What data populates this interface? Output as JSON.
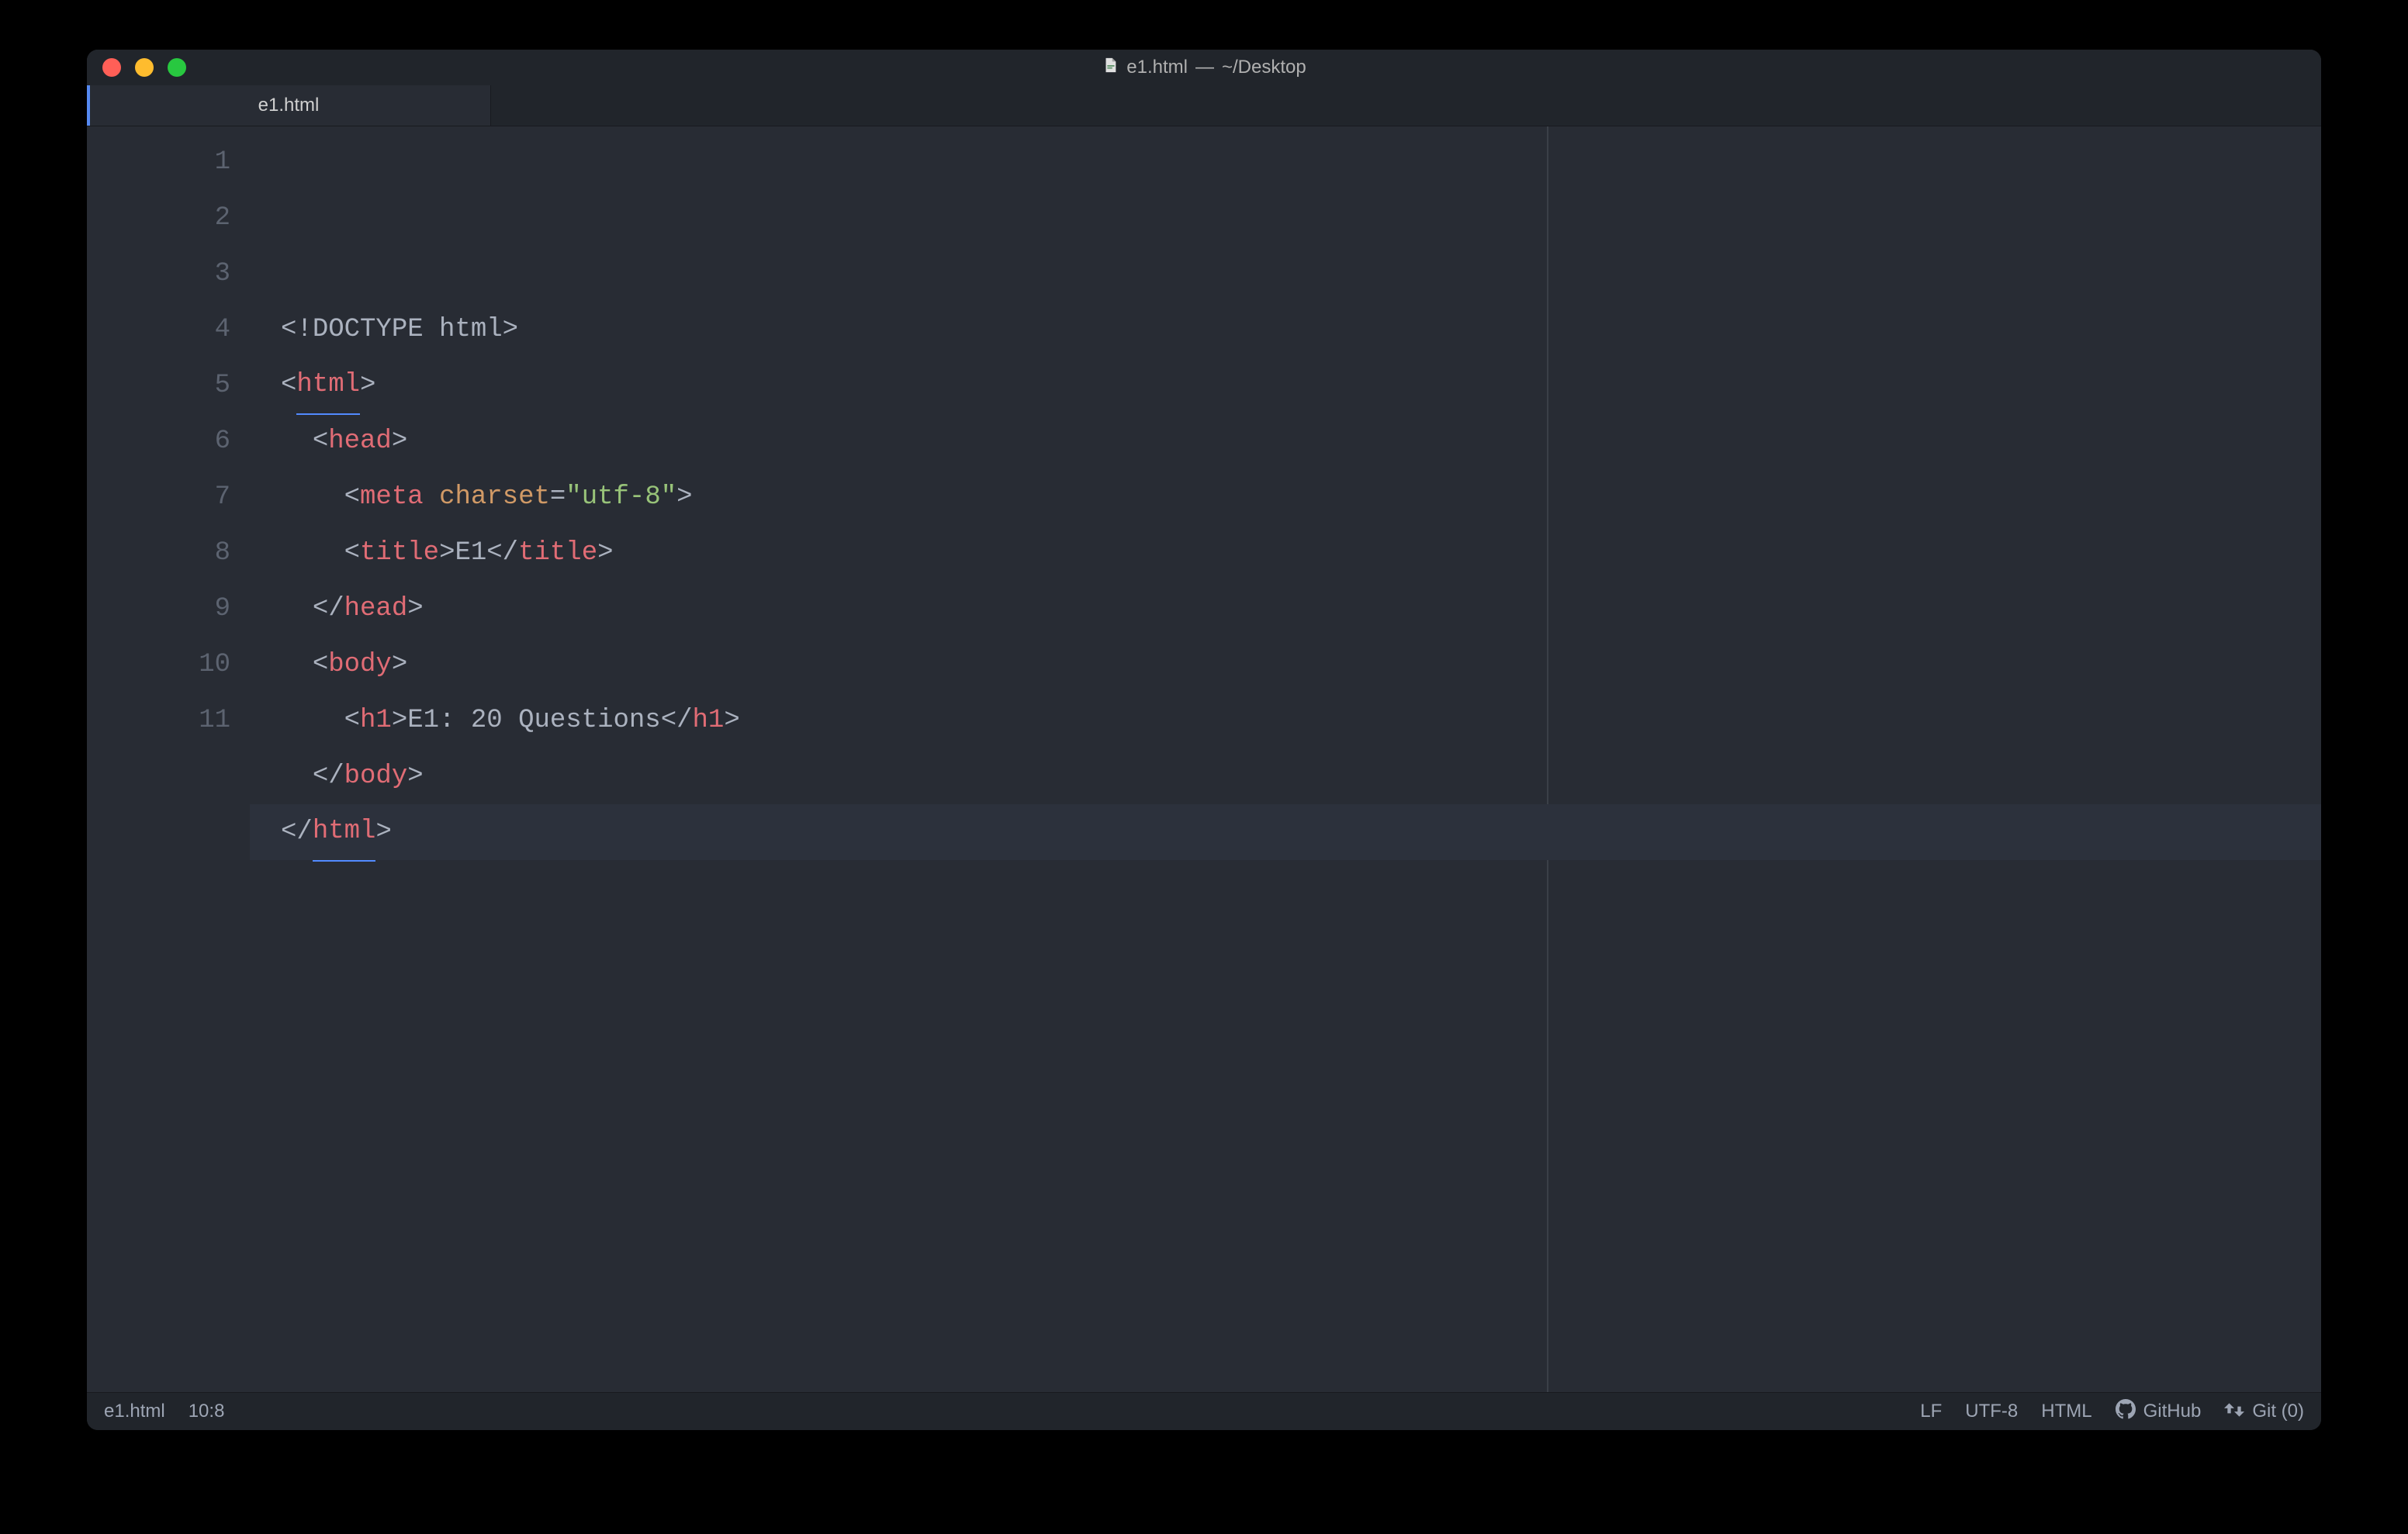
{
  "window": {
    "title_filename": "e1.html",
    "title_separator": " — ",
    "title_path": "~/Desktop"
  },
  "tabs": [
    {
      "label": "e1.html",
      "active": true
    }
  ],
  "editor": {
    "ruler_column": 80,
    "cursor_line": 10,
    "lines": [
      {
        "num": 1,
        "indent": 0,
        "tokens": [
          {
            "t": "punct",
            "v": "<!"
          },
          {
            "t": "text",
            "v": "DOCTYPE html"
          },
          {
            "t": "punct",
            "v": ">"
          }
        ]
      },
      {
        "num": 2,
        "indent": 0,
        "tokens": [
          {
            "t": "punct",
            "v": "<"
          },
          {
            "t": "tag",
            "v": "html",
            "underline": true
          },
          {
            "t": "punct",
            "v": ">"
          }
        ]
      },
      {
        "num": 3,
        "indent": 1,
        "tokens": [
          {
            "t": "punct",
            "v": "<"
          },
          {
            "t": "tag",
            "v": "head"
          },
          {
            "t": "punct",
            "v": ">"
          }
        ]
      },
      {
        "num": 4,
        "indent": 2,
        "tokens": [
          {
            "t": "punct",
            "v": "<"
          },
          {
            "t": "tag",
            "v": "meta"
          },
          {
            "t": "text",
            "v": " "
          },
          {
            "t": "attr",
            "v": "charset"
          },
          {
            "t": "punct",
            "v": "="
          },
          {
            "t": "str",
            "v": "\"utf-8\""
          },
          {
            "t": "punct",
            "v": ">"
          }
        ]
      },
      {
        "num": 5,
        "indent": 2,
        "tokens": [
          {
            "t": "punct",
            "v": "<"
          },
          {
            "t": "tag",
            "v": "title"
          },
          {
            "t": "punct",
            "v": ">"
          },
          {
            "t": "text",
            "v": "E1"
          },
          {
            "t": "punct",
            "v": "</"
          },
          {
            "t": "tag",
            "v": "title"
          },
          {
            "t": "punct",
            "v": ">"
          }
        ]
      },
      {
        "num": 6,
        "indent": 1,
        "tokens": [
          {
            "t": "punct",
            "v": "</"
          },
          {
            "t": "tag",
            "v": "head"
          },
          {
            "t": "punct",
            "v": ">"
          }
        ]
      },
      {
        "num": 7,
        "indent": 1,
        "tokens": [
          {
            "t": "punct",
            "v": "<"
          },
          {
            "t": "tag",
            "v": "body"
          },
          {
            "t": "punct",
            "v": ">"
          }
        ]
      },
      {
        "num": 8,
        "indent": 2,
        "tokens": [
          {
            "t": "punct",
            "v": "<"
          },
          {
            "t": "tag",
            "v": "h1"
          },
          {
            "t": "punct",
            "v": ">"
          },
          {
            "t": "text",
            "v": "E1: 20 Questions"
          },
          {
            "t": "punct",
            "v": "</"
          },
          {
            "t": "tag",
            "v": "h1"
          },
          {
            "t": "punct",
            "v": ">"
          }
        ]
      },
      {
        "num": 9,
        "indent": 1,
        "tokens": [
          {
            "t": "punct",
            "v": "</"
          },
          {
            "t": "tag",
            "v": "body"
          },
          {
            "t": "punct",
            "v": ">"
          }
        ]
      },
      {
        "num": 10,
        "indent": 0,
        "current": true,
        "tokens": [
          {
            "t": "punct",
            "v": "</"
          },
          {
            "t": "tag",
            "v": "html",
            "underline": true
          },
          {
            "t": "punct",
            "v": ">"
          }
        ]
      },
      {
        "num": 11,
        "indent": 0,
        "tokens": []
      }
    ]
  },
  "statusbar": {
    "left": {
      "file": "e1.html",
      "cursor": "10:8"
    },
    "right": {
      "line_ending": "LF",
      "encoding": "UTF-8",
      "language": "HTML",
      "github_label": "GitHub",
      "git_label": "Git (0)"
    }
  }
}
